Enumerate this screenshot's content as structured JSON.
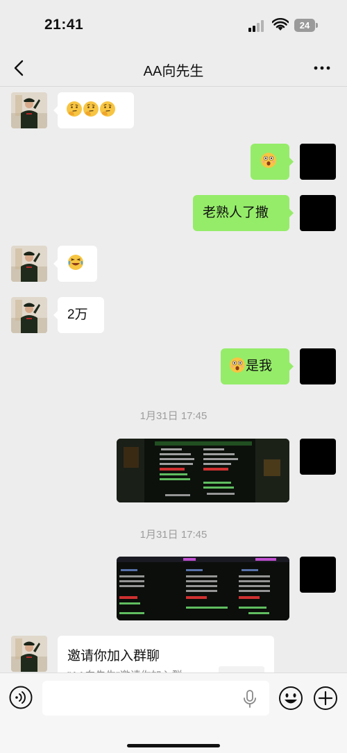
{
  "status_bar": {
    "time": "21:41",
    "battery": "24"
  },
  "nav": {
    "title": "AA向先生",
    "back_icon": "chevron-left-icon",
    "more_icon": "more-dots-icon"
  },
  "messages": {
    "m1": {
      "icon": "thinking-face-emoji"
    },
    "m2": {
      "icon": "astonished-face-emoji"
    },
    "m3": {
      "text": "老熟人了撒"
    },
    "m4": {
      "icon": "rolling-laughing-emoji"
    },
    "m5": {
      "text": "2万"
    },
    "m6": {
      "text": "是我",
      "icon": "astonished-face-emoji"
    }
  },
  "timestamps": [
    "1月31日 17:45",
    "1月31日 17:45"
  ],
  "invite_card": {
    "title": "邀请你加入群聊",
    "desc": "\"AA向先生\"邀请你加入群"
  },
  "input_bar": {
    "placeholder": "",
    "voice_icon": "voice-icon",
    "mic_icon": "microphone-icon",
    "emoji_icon": "smiley-icon",
    "plus_icon": "plus-icon"
  },
  "colors": {
    "outgoing_bubble": "#95ec69",
    "incoming_bubble": "#ffffff",
    "background": "#ededed"
  }
}
